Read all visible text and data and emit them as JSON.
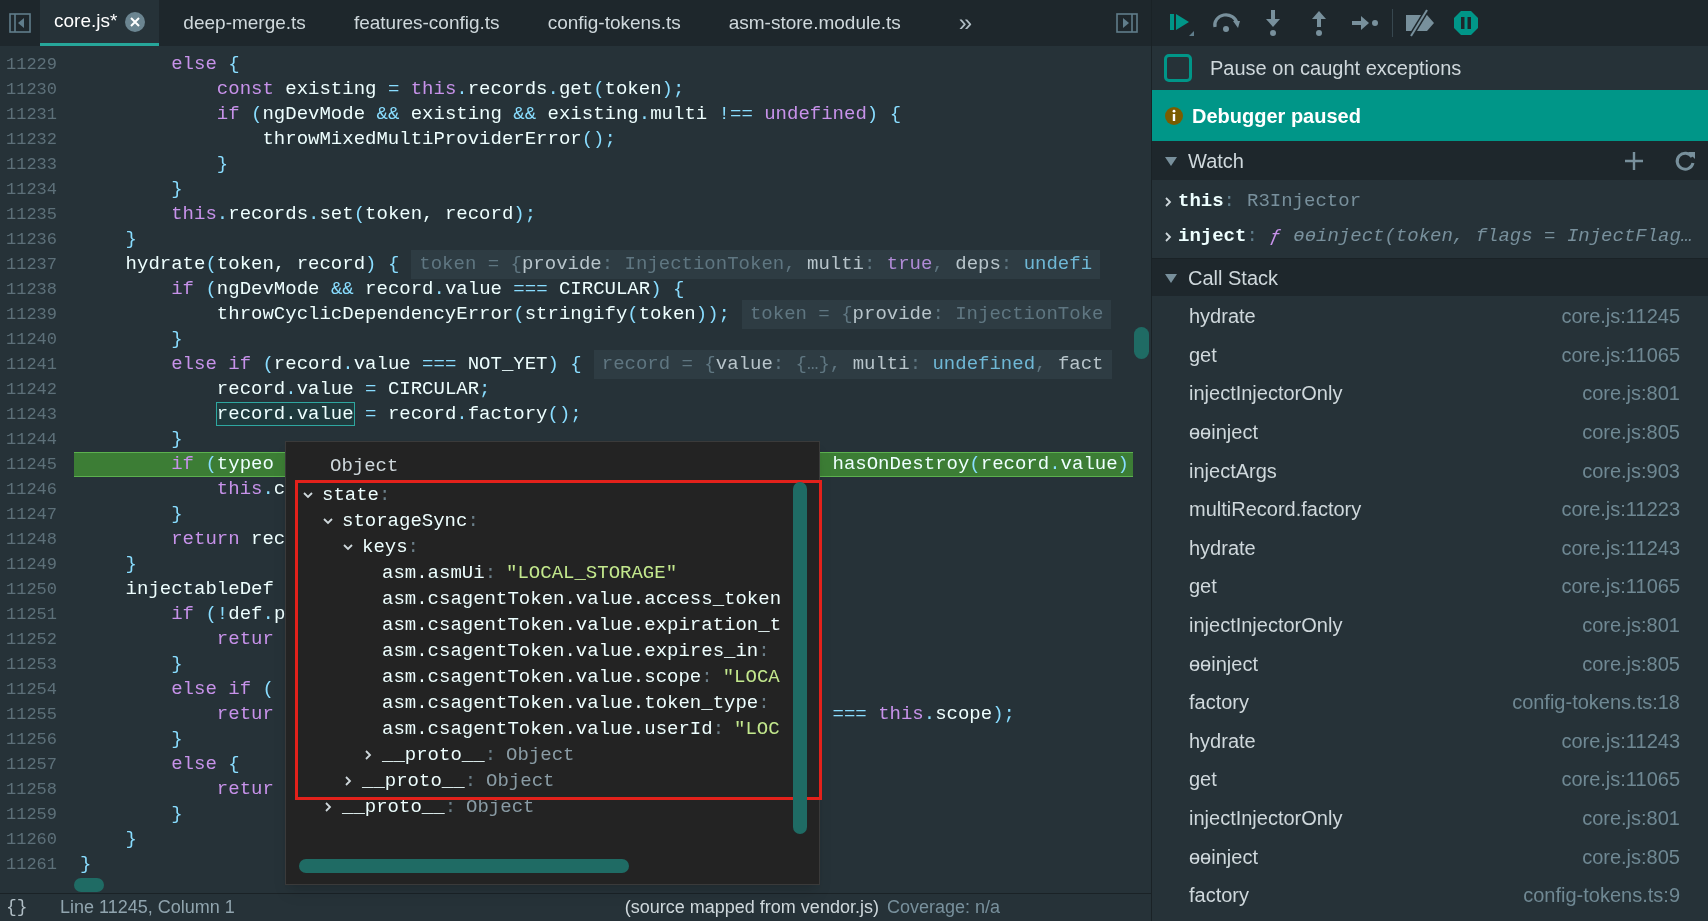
{
  "tabs": [
    {
      "label": "core.js*",
      "selected": true,
      "closable": true
    },
    {
      "label": "deep-merge.ts",
      "selected": false,
      "closable": false
    },
    {
      "label": "features-config.ts",
      "selected": false,
      "closable": false
    },
    {
      "label": "config-tokens.ts",
      "selected": false,
      "closable": false
    },
    {
      "label": "asm-store.module.ts",
      "selected": false,
      "closable": false
    }
  ],
  "tab_overflow": "»",
  "editor": {
    "lines": [
      {
        "number": "11229",
        "current": false,
        "tokens": [
          {
            "text": "        else ",
            "kind": "k"
          },
          {
            "text": "{",
            "kind": "p"
          }
        ]
      },
      {
        "number": "11230",
        "current": false,
        "tokens": [
          {
            "text": "            const ",
            "kind": "k"
          },
          {
            "text": "existing ",
            "kind": "t"
          },
          {
            "text": "= ",
            "kind": "p"
          },
          {
            "text": "this",
            "kind": "k"
          },
          {
            "text": ".",
            "kind": "p"
          },
          {
            "text": "records",
            "kind": "t"
          },
          {
            "text": ".",
            "kind": "p"
          },
          {
            "text": "get",
            "kind": "t"
          },
          {
            "text": "(",
            "kind": "p"
          },
          {
            "text": "token",
            "kind": "t"
          },
          {
            "text": ");",
            "kind": "p"
          }
        ]
      },
      {
        "number": "11231",
        "current": false,
        "tokens": [
          {
            "text": "            if ",
            "kind": "k"
          },
          {
            "text": "(",
            "kind": "p"
          },
          {
            "text": "ngDevMode ",
            "kind": "t"
          },
          {
            "text": "&& ",
            "kind": "p"
          },
          {
            "text": "existing ",
            "kind": "t"
          },
          {
            "text": "&& ",
            "kind": "p"
          },
          {
            "text": "existing",
            "kind": "t"
          },
          {
            "text": ".",
            "kind": "p"
          },
          {
            "text": "multi ",
            "kind": "t"
          },
          {
            "text": "!== ",
            "kind": "p"
          },
          {
            "text": "undefined",
            "kind": "k"
          },
          {
            "text": ") {",
            "kind": "p"
          }
        ]
      },
      {
        "number": "11232",
        "current": false,
        "tokens": [
          {
            "text": "                throwMixedMultiProviderError",
            "kind": "t"
          },
          {
            "text": "();",
            "kind": "p"
          }
        ]
      },
      {
        "number": "11233",
        "current": false,
        "tokens": [
          {
            "text": "            }",
            "kind": "p"
          }
        ]
      },
      {
        "number": "11234",
        "current": false,
        "tokens": [
          {
            "text": "        }",
            "kind": "p"
          }
        ]
      },
      {
        "number": "11235",
        "current": false,
        "tokens": [
          {
            "text": "        this",
            "kind": "k"
          },
          {
            "text": ".",
            "kind": "p"
          },
          {
            "text": "records",
            "kind": "t"
          },
          {
            "text": ".",
            "kind": "p"
          },
          {
            "text": "set",
            "kind": "t"
          },
          {
            "text": "(",
            "kind": "p"
          },
          {
            "text": "token, record",
            "kind": "t"
          },
          {
            "text": ");",
            "kind": "p"
          }
        ]
      },
      {
        "number": "11236",
        "current": false,
        "tokens": [
          {
            "text": "    }",
            "kind": "p"
          }
        ]
      },
      {
        "number": "11237",
        "current": false,
        "tokens": [
          {
            "text": "    hydrate",
            "kind": "t"
          },
          {
            "text": "(",
            "kind": "p"
          },
          {
            "text": "token, record",
            "kind": "t"
          },
          {
            "text": ") {",
            "kind": "p"
          }
        ],
        "hint": [
          {
            "text": "token = {",
            "kind": "hk"
          },
          {
            "text": "provide",
            "kind": "hw"
          },
          {
            "text": ": InjectionToken, ",
            "kind": "hk"
          },
          {
            "text": "multi",
            "kind": "hw"
          },
          {
            "text": ": ",
            "kind": "hk"
          },
          {
            "text": "true",
            "kind": "hp"
          },
          {
            "text": ", ",
            "kind": "hk"
          },
          {
            "text": "deps",
            "kind": "hw"
          },
          {
            "text": ": ",
            "kind": "hk"
          },
          {
            "text": "undefi",
            "kind": "hc"
          }
        ]
      },
      {
        "number": "11238",
        "current": false,
        "tokens": [
          {
            "text": "        if ",
            "kind": "k"
          },
          {
            "text": "(",
            "kind": "p"
          },
          {
            "text": "ngDevMode ",
            "kind": "t"
          },
          {
            "text": "&& ",
            "kind": "p"
          },
          {
            "text": "record",
            "kind": "t"
          },
          {
            "text": ".",
            "kind": "p"
          },
          {
            "text": "value ",
            "kind": "t"
          },
          {
            "text": "=== ",
            "kind": "p"
          },
          {
            "text": "CIRCULAR",
            "kind": "t"
          },
          {
            "text": ") {",
            "kind": "p"
          }
        ]
      },
      {
        "number": "11239",
        "current": false,
        "tokens": [
          {
            "text": "            throwCyclicDependencyError",
            "kind": "t"
          },
          {
            "text": "(",
            "kind": "p"
          },
          {
            "text": "stringify",
            "kind": "t"
          },
          {
            "text": "(",
            "kind": "p"
          },
          {
            "text": "token",
            "kind": "t"
          },
          {
            "text": "));",
            "kind": "p"
          }
        ],
        "hint": [
          {
            "text": "token = {",
            "kind": "hk"
          },
          {
            "text": "provide",
            "kind": "hw"
          },
          {
            "text": ": InjectionToke",
            "kind": "hk"
          }
        ]
      },
      {
        "number": "11240",
        "current": false,
        "tokens": [
          {
            "text": "        }",
            "kind": "p"
          }
        ]
      },
      {
        "number": "11241",
        "current": false,
        "tokens": [
          {
            "text": "        else if ",
            "kind": "k"
          },
          {
            "text": "(",
            "kind": "p"
          },
          {
            "text": "record",
            "kind": "t"
          },
          {
            "text": ".",
            "kind": "p"
          },
          {
            "text": "value ",
            "kind": "t"
          },
          {
            "text": "=== ",
            "kind": "p"
          },
          {
            "text": "NOT_YET",
            "kind": "t"
          },
          {
            "text": ") {",
            "kind": "p"
          }
        ],
        "hint": [
          {
            "text": "record = {",
            "kind": "hk"
          },
          {
            "text": "value",
            "kind": "hw"
          },
          {
            "text": ": {…}, ",
            "kind": "hk"
          },
          {
            "text": "multi",
            "kind": "hw"
          },
          {
            "text": ": ",
            "kind": "hk"
          },
          {
            "text": "undefined",
            "kind": "hc"
          },
          {
            "text": ", ",
            "kind": "hk"
          },
          {
            "text": "fact",
            "kind": "hw"
          }
        ]
      },
      {
        "number": "11242",
        "current": false,
        "tokens": [
          {
            "text": "            record",
            "kind": "t"
          },
          {
            "text": ".",
            "kind": "p"
          },
          {
            "text": "value ",
            "kind": "t"
          },
          {
            "text": "= ",
            "kind": "p"
          },
          {
            "text": "CIRCULAR",
            "kind": "t"
          },
          {
            "text": ";",
            "kind": "p"
          }
        ]
      },
      {
        "number": "11243",
        "current": false,
        "tokens": [
          {
            "text": "            record.value",
            "kind": "sel"
          },
          {
            "text": " = ",
            "kind": "p"
          },
          {
            "text": "record",
            "kind": "t"
          },
          {
            "text": ".",
            "kind": "p"
          },
          {
            "text": "factory",
            "kind": "t"
          },
          {
            "text": "();",
            "kind": "p"
          }
        ]
      },
      {
        "number": "11244",
        "current": false,
        "tokens": [
          {
            "text": "        }",
            "kind": "p"
          }
        ]
      },
      {
        "number": "11245",
        "current": true,
        "tokens": [
          {
            "text": "        if ",
            "kind": "k"
          },
          {
            "text": "(",
            "kind": "p"
          },
          {
            "text": "typeo",
            "kind": "t"
          }
        ],
        "tail": [
          {
            "text": "hasOnDestroy",
            "kind": "t"
          },
          {
            "text": "(",
            "kind": "p"
          },
          {
            "text": "record",
            "kind": "t"
          },
          {
            "text": ".",
            "kind": "p"
          },
          {
            "text": "value",
            "kind": "t"
          },
          {
            "text": ")",
            "kind": "p"
          }
        ]
      },
      {
        "number": "11246",
        "current": false,
        "tokens": [
          {
            "text": "            this",
            "kind": "k"
          },
          {
            "text": ".",
            "kind": "p"
          },
          {
            "text": "c",
            "kind": "t"
          }
        ]
      },
      {
        "number": "11247",
        "current": false,
        "tokens": [
          {
            "text": "        }",
            "kind": "p"
          }
        ]
      },
      {
        "number": "11248",
        "current": false,
        "tokens": [
          {
            "text": "        return ",
            "kind": "k"
          },
          {
            "text": "rec",
            "kind": "t"
          }
        ]
      },
      {
        "number": "11249",
        "current": false,
        "tokens": [
          {
            "text": "    }",
            "kind": "p"
          }
        ]
      },
      {
        "number": "11250",
        "current": false,
        "tokens": [
          {
            "text": "    injectableDef",
            "kind": "t"
          }
        ]
      },
      {
        "number": "11251",
        "current": false,
        "tokens": [
          {
            "text": "        if ",
            "kind": "k"
          },
          {
            "text": "(!",
            "kind": "p"
          },
          {
            "text": "def",
            "kind": "t"
          },
          {
            "text": ".",
            "kind": "p"
          },
          {
            "text": "p",
            "kind": "t"
          }
        ]
      },
      {
        "number": "11252",
        "current": false,
        "tokens": [
          {
            "text": "            retur",
            "kind": "k"
          }
        ]
      },
      {
        "number": "11253",
        "current": false,
        "tokens": [
          {
            "text": "        }",
            "kind": "p"
          }
        ]
      },
      {
        "number": "11254",
        "current": false,
        "tokens": [
          {
            "text": "        else if ",
            "kind": "k"
          },
          {
            "text": "(",
            "kind": "p"
          }
        ]
      },
      {
        "number": "11255",
        "current": false,
        "tokens": [
          {
            "text": "            retur",
            "kind": "k"
          }
        ],
        "tail": [
          {
            "text": "=== ",
            "kind": "p"
          },
          {
            "text": "this",
            "kind": "k"
          },
          {
            "text": ".",
            "kind": "p"
          },
          {
            "text": "scope",
            "kind": "t"
          },
          {
            "text": ");",
            "kind": "p"
          }
        ]
      },
      {
        "number": "11256",
        "current": false,
        "tokens": [
          {
            "text": "        }",
            "kind": "p"
          }
        ]
      },
      {
        "number": "11257",
        "current": false,
        "tokens": [
          {
            "text": "        else ",
            "kind": "k"
          },
          {
            "text": "{",
            "kind": "p"
          }
        ]
      },
      {
        "number": "11258",
        "current": false,
        "tokens": [
          {
            "text": "            retur",
            "kind": "k"
          }
        ]
      },
      {
        "number": "11259",
        "current": false,
        "tokens": [
          {
            "text": "        }",
            "kind": "p"
          }
        ]
      },
      {
        "number": "11260",
        "current": false,
        "tokens": [
          {
            "text": "    }",
            "kind": "p"
          }
        ]
      },
      {
        "number": "11261",
        "current": false,
        "tokens": [
          {
            "text": "}",
            "kind": "p"
          }
        ]
      }
    ],
    "popup": {
      "title": "Object",
      "tree": [
        {
          "kind": "group",
          "key": "state",
          "separator": ":",
          "expanded": true,
          "children": [
            {
              "kind": "group",
              "key": "storageSync",
              "separator": ":",
              "expanded": true,
              "children": [
                {
                  "kind": "group",
                  "key": "keys",
                  "separator": ":",
                  "expanded": true,
                  "children": [
                    {
                      "kind": "leaf",
                      "key": "asm.asmUi",
                      "separator": ":",
                      "value": {
                        "text": "\"LOCAL_STORAGE\"",
                        "kind": "string"
                      }
                    },
                    {
                      "kind": "leaf",
                      "key": "asm.csagentToken.value.access_token"
                    },
                    {
                      "kind": "leaf",
                      "key": "asm.csagentToken.value.expiration_t"
                    },
                    {
                      "kind": "leaf",
                      "key": "asm.csagentToken.value.expires_in",
                      "separator": ":"
                    },
                    {
                      "kind": "leaf",
                      "key": "asm.csagentToken.value.scope",
                      "separator": ":",
                      "value": {
                        "text": "\"LOCA",
                        "kind": "string"
                      }
                    },
                    {
                      "kind": "leaf",
                      "key": "asm.csagentToken.value.token_type",
                      "separator": ":"
                    },
                    {
                      "kind": "leaf",
                      "key": "asm.csagentToken.value.userId",
                      "separator": ":",
                      "value": {
                        "text": "\"LOC",
                        "kind": "string"
                      }
                    },
                    {
                      "kind": "group",
                      "key": "__proto__",
                      "separator": ":",
                      "expanded": false,
                      "value": {
                        "text": "Object",
                        "kind": "object"
                      }
                    }
                  ]
                },
                {
                  "kind": "group",
                  "key": "__proto__",
                  "separator": ":",
                  "expanded": false,
                  "value": {
                    "text": "Object",
                    "kind": "object"
                  }
                }
              ]
            },
            {
              "kind": "group",
              "key": "__proto__",
              "separator": ":",
              "expanded": false,
              "value": {
                "text": "Object",
                "kind": "object"
              }
            }
          ]
        }
      ]
    }
  },
  "status_bar": {
    "glyph": "{}",
    "position": "Line 11245, Column 1",
    "source": "(source mapped from vendor.js)",
    "coverage": "Coverage: n/a"
  },
  "debugger": {
    "pause_on_caught": {
      "label": "Pause on caught exceptions",
      "checked": false
    },
    "banner": "Debugger paused",
    "watch": {
      "title": "Watch",
      "expanded": true,
      "items": [
        {
          "name": "this",
          "separator": ":",
          "kind": "object",
          "value": "R3Injector",
          "expanded": false
        },
        {
          "name": "inject",
          "separator": ":",
          "kind": "function",
          "marker": "ƒ",
          "value": "ɵɵinject(token, flags = InjectFlag…",
          "expanded": false
        }
      ]
    },
    "call_stack": {
      "title": "Call Stack",
      "expanded": true,
      "frames": [
        {
          "name": "hydrate",
          "location": "core.js:11245"
        },
        {
          "name": "get",
          "location": "core.js:11065"
        },
        {
          "name": "injectInjectorOnly",
          "location": "core.js:801"
        },
        {
          "name": "ɵɵinject",
          "location": "core.js:805"
        },
        {
          "name": "injectArgs",
          "location": "core.js:903"
        },
        {
          "name": "multiRecord.factory",
          "location": "core.js:11223"
        },
        {
          "name": "hydrate",
          "location": "core.js:11243"
        },
        {
          "name": "get",
          "location": "core.js:11065"
        },
        {
          "name": "injectInjectorOnly",
          "location": "core.js:801"
        },
        {
          "name": "ɵɵinject",
          "location": "core.js:805"
        },
        {
          "name": "factory",
          "location": "config-tokens.ts:18"
        },
        {
          "name": "hydrate",
          "location": "core.js:11243"
        },
        {
          "name": "get",
          "location": "core.js:11065"
        },
        {
          "name": "injectInjectorOnly",
          "location": "core.js:801"
        },
        {
          "name": "ɵɵinject",
          "location": "core.js:805"
        },
        {
          "name": "factory",
          "location": "config-tokens.ts:9"
        }
      ]
    }
  }
}
